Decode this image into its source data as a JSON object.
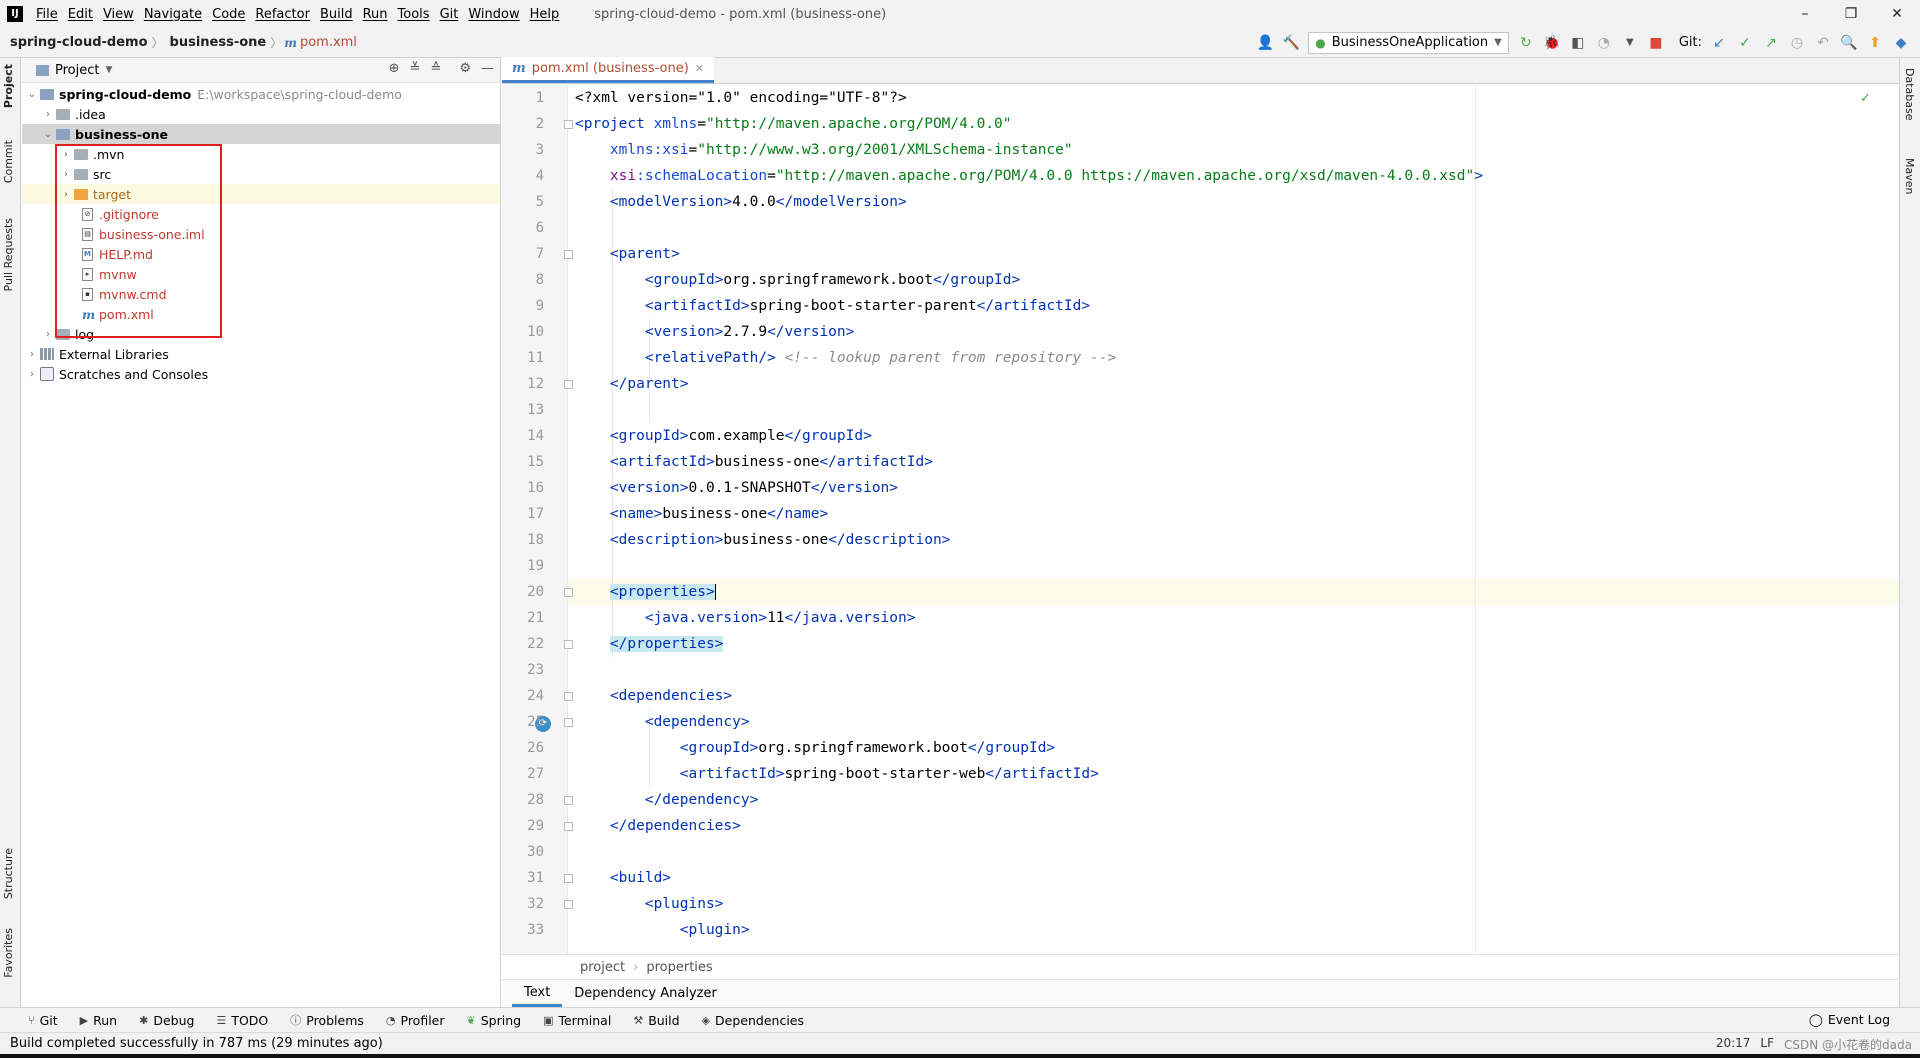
{
  "app": {
    "logo": "IJ",
    "window_title": "spring-cloud-demo - pom.xml (business-one)",
    "menu": [
      "File",
      "Edit",
      "View",
      "Navigate",
      "Code",
      "Refactor",
      "Build",
      "Run",
      "Tools",
      "Git",
      "Window",
      "Help"
    ],
    "win_controls": [
      "–",
      "❐",
      "✕"
    ]
  },
  "navbar": {
    "crumbs": [
      "spring-cloud-demo",
      "business-one"
    ],
    "file": "pom.xml",
    "run_config": "BusinessOneApplication",
    "git_label": "Git:"
  },
  "left_strip": [
    "Project",
    "Commit",
    "Pull Requests",
    "Structure",
    "Favorites"
  ],
  "right_strip": [
    "Database",
    "Maven"
  ],
  "project": {
    "title": "Project",
    "root": {
      "name": "spring-cloud-demo",
      "path": "E:\\workspace\\spring-cloud-demo"
    },
    "tree": [
      {
        "label": ".idea"
      },
      {
        "label": "business-one"
      },
      {
        "label": ".mvn"
      },
      {
        "label": "src"
      },
      {
        "label": "target"
      },
      {
        "label": ".gitignore"
      },
      {
        "label": "business-one.iml"
      },
      {
        "label": "HELP.md"
      },
      {
        "label": "mvnw"
      },
      {
        "label": "mvnw.cmd"
      },
      {
        "label": "pom.xml"
      },
      {
        "label": "log"
      },
      {
        "label": "External Libraries"
      },
      {
        "label": "Scratches and Consoles"
      }
    ]
  },
  "editor": {
    "tab": "pom.xml (business-one)",
    "line_numbers": [
      "1",
      "2",
      "3",
      "4",
      "5",
      "6",
      "7",
      "8",
      "9",
      "10",
      "11",
      "12",
      "13",
      "14",
      "15",
      "16",
      "17",
      "18",
      "19",
      "20",
      "21",
      "22",
      "23",
      "24",
      "25",
      "26",
      "27",
      "28",
      "29",
      "30",
      "31",
      "32",
      "33"
    ],
    "breadcrumb": [
      "project",
      "properties"
    ],
    "bottom_tabs": [
      "Text",
      "Dependency Analyzer"
    ]
  },
  "code": {
    "l1": "<?xml version=\"1.0\" encoding=\"UTF-8\"?>",
    "l2_tag": "<project",
    "l2_attr": "xmlns",
    "l2_val": "\"http://maven.apache.org/POM/4.0.0\"",
    "l3_ns": "xmlns:xsi",
    "l3_val": "\"http://www.w3.org/2001/XMLSchema-instance\"",
    "l4_ns": "xsi",
    "l4_attr": ":schemaLocation",
    "l4_val": "\"http://maven.apache.org/POM/4.0.0 https://maven.apache.org/xsd/maven-4.0.0.xsd\"",
    "model_version": "4.0.0",
    "parent_group": "org.springframework.boot",
    "parent_artifact": "spring-boot-starter-parent",
    "parent_version": "2.7.9",
    "relative_comment": "<!-- lookup parent from repository -->",
    "group": "com.example",
    "artifact": "business-one",
    "version": "0.0.1-SNAPSHOT",
    "name": "business-one",
    "description": "business-one",
    "java_version": "11",
    "dep_group": "org.springframework.boot",
    "dep_artifact": "spring-boot-starter-web"
  },
  "toolwindows": [
    "Git",
    "Run",
    "Debug",
    "TODO",
    "Problems",
    "Profiler",
    "Spring",
    "Terminal",
    "Build",
    "Dependencies"
  ],
  "event_log": "Event Log",
  "status": {
    "message": "Build completed successfully in 787 ms (29 minutes ago)",
    "position": "20:17",
    "line_sep": "LF",
    "watermark": "CSDN @小花卷的dada"
  }
}
